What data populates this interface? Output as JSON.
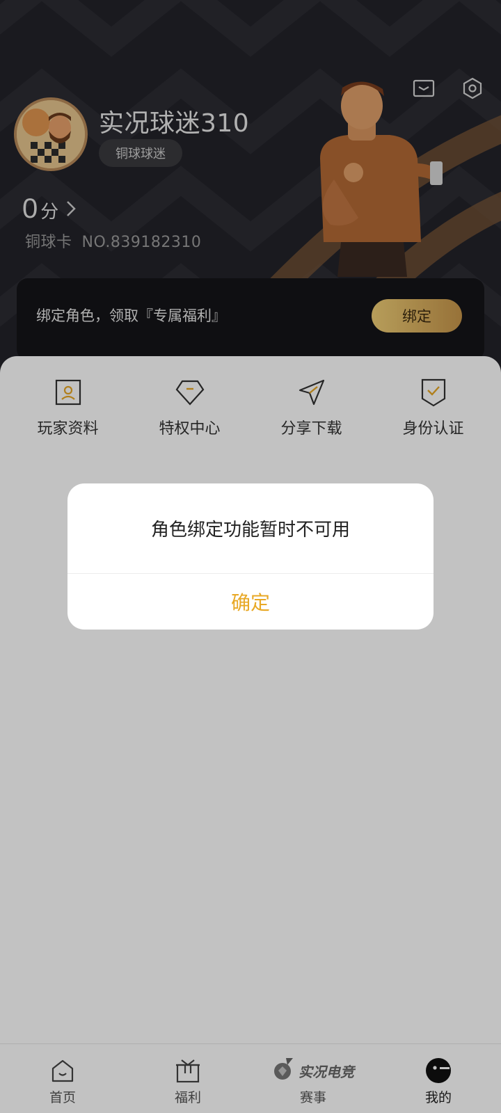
{
  "profile": {
    "username": "实况球迷310",
    "level": "铜球球迷",
    "points_value": "0",
    "points_unit": "分",
    "card_label": "铜球卡",
    "card_number": "NO.839182310"
  },
  "header_icons": [
    "mail-icon",
    "settings-hexagon-icon"
  ],
  "bind_banner": {
    "text": "绑定角色，领取『专属福利』",
    "button": "绑定"
  },
  "quick_actions": [
    {
      "label": "玩家资料",
      "icon": "player-profile-icon"
    },
    {
      "label": "特权中心",
      "icon": "privilege-diamond-icon"
    },
    {
      "label": "分享下载",
      "icon": "share-plane-icon"
    },
    {
      "label": "身份认证",
      "icon": "verified-shield-icon"
    }
  ],
  "tabbar": {
    "tabs": [
      {
        "label": "首页",
        "icon": "home-icon"
      },
      {
        "label": "福利",
        "icon": "gift-icon"
      },
      {
        "label": "赛事",
        "icon": "esports-logo-icon",
        "brand": "实况电竞"
      },
      {
        "label": "我的",
        "icon": "profile-face-icon"
      }
    ],
    "active": "我的"
  },
  "dialog": {
    "message": "角色绑定功能暂时不可用",
    "confirm": "确定"
  },
  "colors": {
    "accent": "#e8a825",
    "gold_button": "#e0b865",
    "header_bg": "#23232a"
  }
}
